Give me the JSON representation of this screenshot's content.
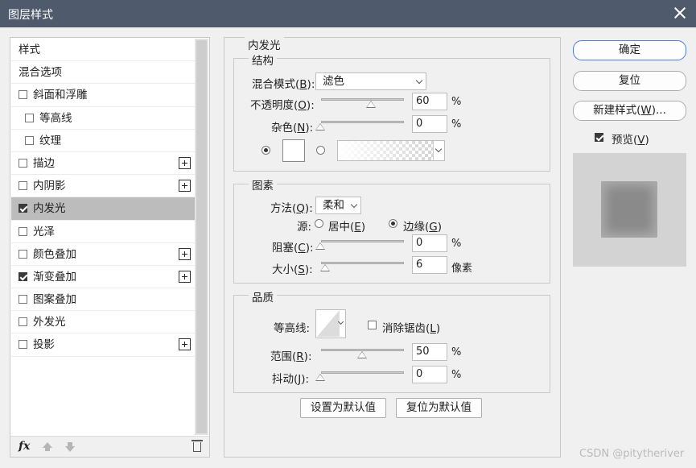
{
  "window": {
    "title": "图层样式"
  },
  "styles_list": [
    {
      "label": "样式",
      "type": "header",
      "checkbox": false,
      "checked": false,
      "plus": false,
      "selected": false,
      "indent": false
    },
    {
      "label": "混合选项",
      "type": "header",
      "checkbox": false,
      "checked": false,
      "plus": false,
      "selected": false,
      "indent": false
    },
    {
      "label": "斜面和浮雕",
      "type": "item",
      "checkbox": true,
      "checked": false,
      "plus": false,
      "selected": false,
      "indent": false
    },
    {
      "label": "等高线",
      "type": "item",
      "checkbox": true,
      "checked": false,
      "plus": false,
      "selected": false,
      "indent": true
    },
    {
      "label": "纹理",
      "type": "item",
      "checkbox": true,
      "checked": false,
      "plus": false,
      "selected": false,
      "indent": true
    },
    {
      "label": "描边",
      "type": "item",
      "checkbox": true,
      "checked": false,
      "plus": true,
      "selected": false,
      "indent": false
    },
    {
      "label": "内阴影",
      "type": "item",
      "checkbox": true,
      "checked": false,
      "plus": true,
      "selected": false,
      "indent": false
    },
    {
      "label": "内发光",
      "type": "item",
      "checkbox": true,
      "checked": true,
      "plus": false,
      "selected": true,
      "indent": false
    },
    {
      "label": "光泽",
      "type": "item",
      "checkbox": true,
      "checked": false,
      "plus": false,
      "selected": false,
      "indent": false
    },
    {
      "label": "颜色叠加",
      "type": "item",
      "checkbox": true,
      "checked": false,
      "plus": true,
      "selected": false,
      "indent": false
    },
    {
      "label": "渐变叠加",
      "type": "item",
      "checkbox": true,
      "checked": true,
      "plus": true,
      "selected": false,
      "indent": false
    },
    {
      "label": "图案叠加",
      "type": "item",
      "checkbox": true,
      "checked": false,
      "plus": false,
      "selected": false,
      "indent": false
    },
    {
      "label": "外发光",
      "type": "item",
      "checkbox": true,
      "checked": false,
      "plus": false,
      "selected": false,
      "indent": false
    },
    {
      "label": "投影",
      "type": "item",
      "checkbox": true,
      "checked": false,
      "plus": true,
      "selected": false,
      "indent": false
    }
  ],
  "bottom_toolbar": {
    "fx_label": "fx"
  },
  "inner_glow": {
    "title": "内发光",
    "structure": {
      "title": "结构",
      "blend_mode_label": "混合模式(",
      "blend_mode_key": "B",
      "blend_mode_value": "滤色",
      "opacity_label": "不透明度(",
      "opacity_key": "O",
      "opacity_value": "60",
      "opacity_unit": "%",
      "noise_label": "杂色(",
      "noise_key": "N",
      "noise_value": "0",
      "noise_unit": "%",
      "color_mode": "solid",
      "color": "#ffffff"
    },
    "elements": {
      "title": "图素",
      "method_label": "方法(",
      "method_key": "Q",
      "method_value": "柔和",
      "source_label": "源:",
      "source_center_label": "居中(",
      "source_center_key": "E",
      "source_edge_label": "边缘(",
      "source_edge_key": "G",
      "source_selected": "edge",
      "choke_label": "阻塞(",
      "choke_key": "C",
      "choke_value": "0",
      "choke_unit": "%",
      "size_label": "大小(",
      "size_key": "S",
      "size_value": "6",
      "size_unit": "像素"
    },
    "quality": {
      "title": "品质",
      "contour_label": "等高线:",
      "antialias_label": "消除锯齿(",
      "antialias_key": "L",
      "antialias_checked": false,
      "range_label": "范围(",
      "range_key": "R",
      "range_value": "50",
      "range_unit": "%",
      "jitter_label": "抖动(",
      "jitter_key": "J",
      "jitter_value": "0",
      "jitter_unit": "%"
    },
    "set_default_label": "设置为默认值",
    "reset_default_label": "复位为默认值"
  },
  "side_buttons": {
    "ok_label": "确定",
    "reset_label": "复位",
    "new_style_label": "新建样式(",
    "new_style_key": "W",
    "new_style_suffix": ")...",
    "preview_label": "预览(",
    "preview_key": "V",
    "preview_checked": true
  },
  "watermark": "CSDN @pitytheriver",
  "colors": {
    "titlebar": "#4f5b6c",
    "primary_button_border": "#4a7ed8",
    "selected_row": "#bcbcbc"
  },
  "icons": [
    "close-icon",
    "plus-icon",
    "fx-icon",
    "move-up-icon",
    "move-down-icon",
    "trash-icon",
    "chevron-down-icon"
  ]
}
